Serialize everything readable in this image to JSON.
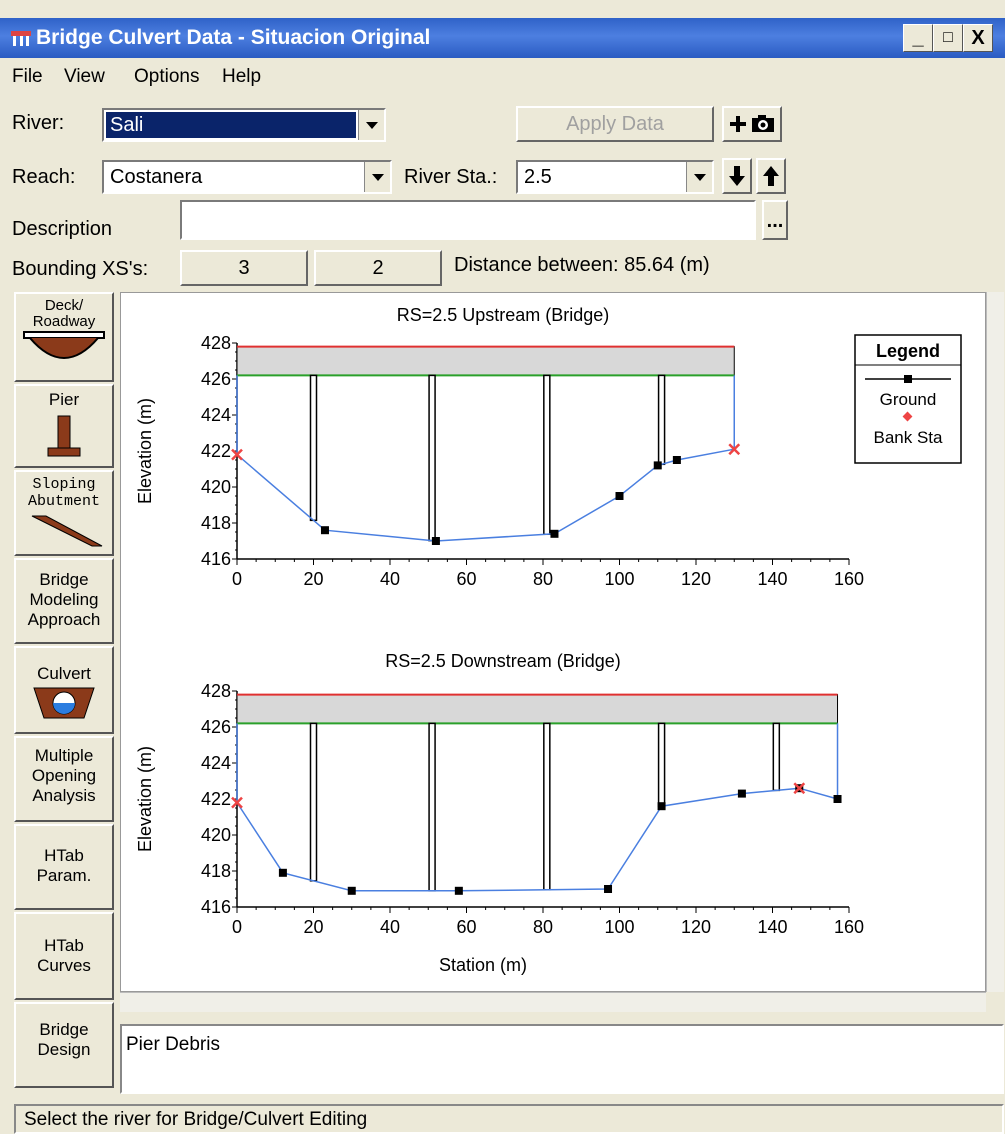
{
  "window": {
    "title": "Bridge Culvert Data - Situacion Original",
    "controls": [
      "_",
      "□",
      "X"
    ]
  },
  "menu": [
    "File",
    "View",
    "Options",
    "Help"
  ],
  "form": {
    "river_label": "River:",
    "river_value": "Sali",
    "apply_label": "Apply Data",
    "reach_label": "Reach:",
    "reach_value": "Costanera",
    "river_sta_label": "River Sta.:",
    "river_sta_value": "2.5",
    "description_label": "Description",
    "description_value": "",
    "bounding_label": "Bounding XS's:",
    "bounding_1": "3",
    "bounding_2": "2",
    "distance_text": "Distance between: 85.64 (m)",
    "ellipsis": "..."
  },
  "sidebar": [
    {
      "label": "Deck/ Roadway",
      "icon": "deck-roadway-icon"
    },
    {
      "label": "Pier",
      "icon": "pier-icon"
    },
    {
      "label": "Sloping Abutment",
      "icon": "sloping-abutment-icon"
    },
    {
      "label": "Bridge Modeling Approach",
      "icon": ""
    },
    {
      "label": "Culvert",
      "icon": "culvert-icon"
    },
    {
      "label": "Multiple Opening Analysis",
      "icon": ""
    },
    {
      "label": "HTab Param.",
      "icon": ""
    },
    {
      "label": "HTab Curves",
      "icon": ""
    },
    {
      "label": "Bridge Design",
      "icon": ""
    }
  ],
  "legend": {
    "title": "Legend",
    "items": [
      "Ground",
      "Bank Sta"
    ]
  },
  "chart_data": [
    {
      "type": "line",
      "title": "RS=2.5    Upstream  (Bridge)",
      "xlabel": "",
      "ylabel": "Elevation (m)",
      "xlim": [
        0,
        160
      ],
      "ylim": [
        416,
        428
      ],
      "xticks": [
        0,
        20,
        40,
        60,
        80,
        100,
        120,
        140,
        160
      ],
      "yticks": [
        416,
        418,
        420,
        422,
        424,
        426,
        428
      ],
      "ground": {
        "x": [
          0,
          23,
          52,
          83,
          100,
          110,
          115,
          130
        ],
        "y": [
          421.8,
          417.6,
          417.0,
          417.4,
          419.5,
          421.2,
          421.5,
          422.1
        ]
      },
      "bank_sta": {
        "x": [
          0,
          130
        ],
        "y": [
          421.8,
          422.1
        ]
      },
      "deck": {
        "x_start": 0,
        "x_end": 130,
        "high_chord": 427.8,
        "low_chord": 426.2
      },
      "piers": [
        20,
        51,
        81,
        111
      ]
    },
    {
      "type": "line",
      "title": "RS=2.5    Downstream  (Bridge)",
      "xlabel": "Station (m)",
      "ylabel": "Elevation (m)",
      "xlim": [
        0,
        160
      ],
      "ylim": [
        416,
        428
      ],
      "xticks": [
        0,
        20,
        40,
        60,
        80,
        100,
        120,
        140,
        160
      ],
      "yticks": [
        416,
        418,
        420,
        422,
        424,
        426,
        428
      ],
      "ground": {
        "x": [
          0,
          12,
          30,
          58,
          97,
          111,
          132,
          147,
          157
        ],
        "y": [
          421.8,
          417.9,
          416.9,
          416.9,
          417.0,
          421.6,
          422.3,
          422.6,
          422.0
        ]
      },
      "bank_sta": {
        "x": [
          0,
          147
        ],
        "y": [
          421.8,
          422.6
        ]
      },
      "deck": {
        "x_start": 0,
        "x_end": 157,
        "high_chord": 427.8,
        "low_chord": 426.2
      },
      "piers": [
        20,
        51,
        81,
        111,
        141
      ]
    }
  ],
  "desc_box": "Pier Debris",
  "status": "Select the river for Bridge/Culvert Editing",
  "colors": {
    "high_chord": "#e03030",
    "low_chord": "#2aa02a",
    "deck_fill": "#d8d8d8",
    "ground": "#4a7fe0",
    "bank": "#ee4444",
    "title_bar": "#2f62c8"
  }
}
